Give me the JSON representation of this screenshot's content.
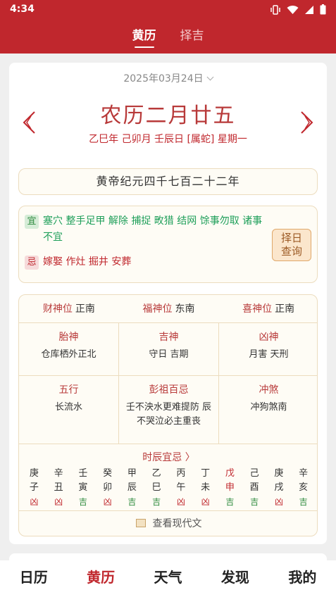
{
  "status": {
    "time": "4:34"
  },
  "tabs": [
    {
      "label": "黄历",
      "active": true
    },
    {
      "label": "择吉",
      "active": false
    }
  ],
  "date": {
    "solar": "2025年03月24日",
    "lunar": "农历二月廿五",
    "ganzhi": "乙巳年 己卯月 壬辰日 [属蛇] 星期一"
  },
  "emperor_year": "黄帝纪元四千七百二十二年",
  "yiji": {
    "yi_label": "宜",
    "yi_text": "塞穴 整手足甲 解除 捕捉 畋猎 结网 馀事勿取 诸事不宜",
    "ji_label": "忌",
    "ji_text": "嫁娶 作灶 掘井 安葬",
    "button": "择日查询"
  },
  "gods": [
    {
      "label": "财神位",
      "value": "正南"
    },
    {
      "label": "福神位",
      "value": "东南"
    },
    {
      "label": "喜神位",
      "value": "正南"
    }
  ],
  "grid": [
    {
      "title": "胎神",
      "value": "仓库栖外正北"
    },
    {
      "title": "吉神",
      "value": "守日 吉期"
    },
    {
      "title": "凶神",
      "value": "月害 天刑"
    },
    {
      "title": "五行",
      "value": "长流水"
    },
    {
      "title": "彭祖百忌",
      "value": "壬不泱水更难提防 辰不哭泣必主重丧"
    },
    {
      "title": "冲煞",
      "value": "冲狗煞南"
    }
  ],
  "shichen_title": "时辰宜忌 〉",
  "shichen": [
    {
      "gan": "庚",
      "zhi": "子",
      "luck": "凶"
    },
    {
      "gan": "辛",
      "zhi": "丑",
      "luck": "凶"
    },
    {
      "gan": "壬",
      "zhi": "寅",
      "luck": "吉"
    },
    {
      "gan": "癸",
      "zhi": "卯",
      "luck": "凶"
    },
    {
      "gan": "甲",
      "zhi": "辰",
      "luck": "吉"
    },
    {
      "gan": "乙",
      "zhi": "巳",
      "luck": "吉"
    },
    {
      "gan": "丙",
      "zhi": "午",
      "luck": "凶"
    },
    {
      "gan": "丁",
      "zhi": "未",
      "luck": "凶"
    },
    {
      "gan": "戊",
      "zhi": "申",
      "luck": "吉",
      "current": true
    },
    {
      "gan": "己",
      "zhi": "酉",
      "luck": "吉"
    },
    {
      "gan": "庚",
      "zhi": "戌",
      "luck": "凶"
    },
    {
      "gan": "辛",
      "zhi": "亥",
      "luck": "吉"
    }
  ],
  "modern_link": "查看现代文",
  "bottom_nav": [
    {
      "label": "日历",
      "active": false
    },
    {
      "label": "黄历",
      "active": true
    },
    {
      "label": "天气",
      "active": false
    },
    {
      "label": "发现",
      "active": false
    },
    {
      "label": "我的",
      "active": false
    }
  ],
  "colors": {
    "brand": "#c0272d",
    "yi": "#1f9f5a",
    "ji": "#c0272d",
    "border": "#ecdcbe"
  }
}
